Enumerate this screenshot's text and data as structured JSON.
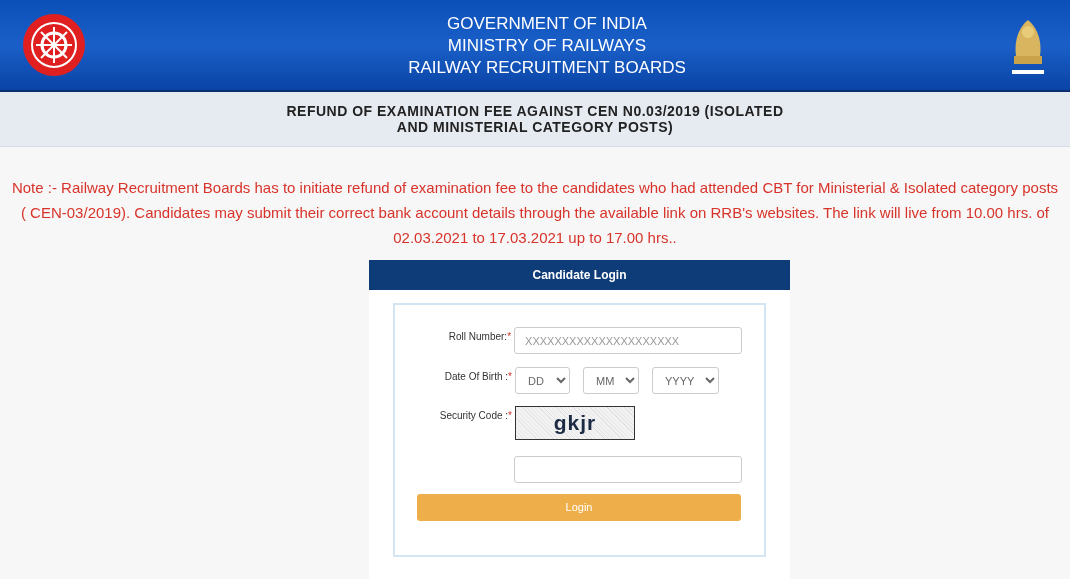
{
  "header": {
    "lines": [
      "GOVERNMENT OF INDIA",
      "MINISTRY OF RAILWAYS",
      "RAILWAY RECRUITMENT BOARDS"
    ]
  },
  "page_title": [
    "REFUND OF EXAMINATION FEE AGAINST CEN N0.03/2019 (ISOLATED",
    "AND MINISTERIAL CATEGORY POSTS)"
  ],
  "note": "Note :- Railway Recruitment Boards has to initiate refund of examination fee to the candidates who had attended CBT for Ministerial & Isolated category posts ( CEN-03/2019). Candidates may submit their correct bank account details through the available link on RRB's websites. The link will live from 10.00 hrs. of 02.03.2021 to 17.03.2021 up to 17.00 hrs..",
  "login": {
    "title": "Candidate Login",
    "roll_number": {
      "label": "Roll Number:",
      "required_mark": "*",
      "placeholder": "XXXXXXXXXXXXXXXXXXXXX"
    },
    "date_of_birth": {
      "label": "Date Of Birth :",
      "required_mark": "*",
      "selects": [
        "DD",
        "MM",
        "YYYY"
      ]
    },
    "security_code": {
      "label": "Security Code :",
      "required_mark": "*",
      "captcha": "gkjr"
    },
    "button": "Login"
  }
}
